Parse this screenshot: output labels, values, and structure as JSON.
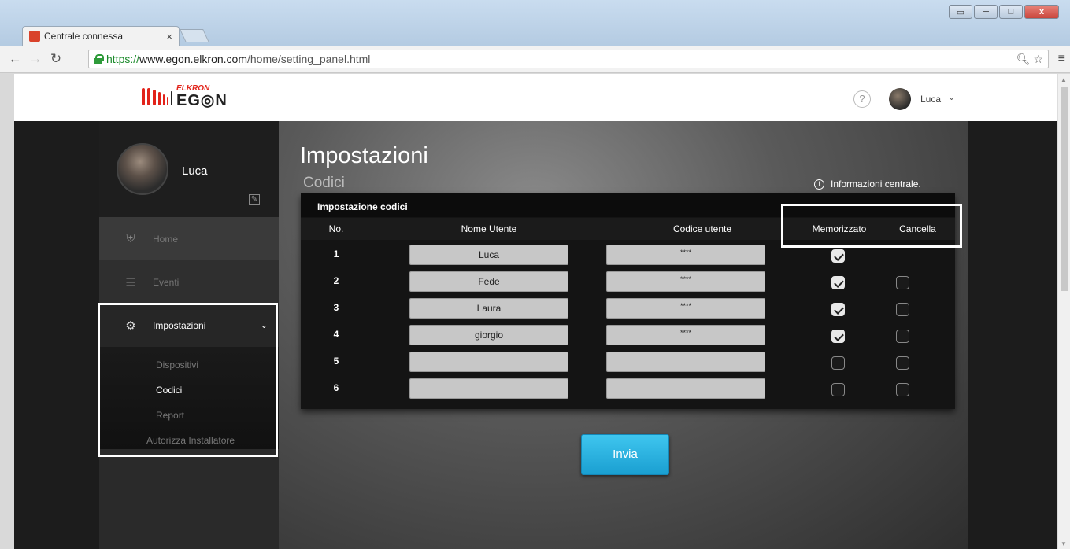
{
  "browser": {
    "tab_title": "Centrale connessa",
    "tab_close": "×",
    "url_scheme": "https://",
    "url_host": "www.egon.elkron.com",
    "url_path": "/home/setting_panel.html",
    "window_buttons": [
      "▭",
      "─",
      "□",
      "x"
    ]
  },
  "header": {
    "logo_top": "ELKRON",
    "logo_bottom": "EG◎N",
    "help": "?",
    "user": "Luca"
  },
  "sidebar": {
    "profile_name": "Luca",
    "items": [
      {
        "label": "Home",
        "icon": "shield-icon"
      },
      {
        "label": "Eventi",
        "icon": "list-icon"
      },
      {
        "label": "Impostazioni",
        "icon": "gear-icon"
      }
    ],
    "submenu": [
      "Dispositivi",
      "Codici",
      "Report",
      "Autorizza Installatore"
    ]
  },
  "main": {
    "title": "Impostazioni",
    "subtitle": "Codici",
    "info_link": "Informazioni centrale.",
    "panel_title": "Impostazione codici",
    "columns": [
      "No.",
      "Nome Utente",
      "Codice utente",
      "Memorizzato",
      "Cancella"
    ],
    "rows": [
      {
        "no": "1",
        "name": "Luca",
        "code": "****",
        "stored": true,
        "delete": null
      },
      {
        "no": "2",
        "name": "Fede",
        "code": "****",
        "stored": true,
        "delete": false
      },
      {
        "no": "3",
        "name": "Laura",
        "code": "****",
        "stored": true,
        "delete": false
      },
      {
        "no": "4",
        "name": "giorgio",
        "code": "****",
        "stored": true,
        "delete": false
      },
      {
        "no": "5",
        "name": "",
        "code": "",
        "stored": false,
        "delete": false
      },
      {
        "no": "6",
        "name": "",
        "code": "",
        "stored": false,
        "delete": false
      }
    ],
    "submit_label": "Invia"
  },
  "colors": {
    "brand_red": "#e2231a",
    "button_blue": "#1a9fd1",
    "highlight": "#ffffff"
  }
}
